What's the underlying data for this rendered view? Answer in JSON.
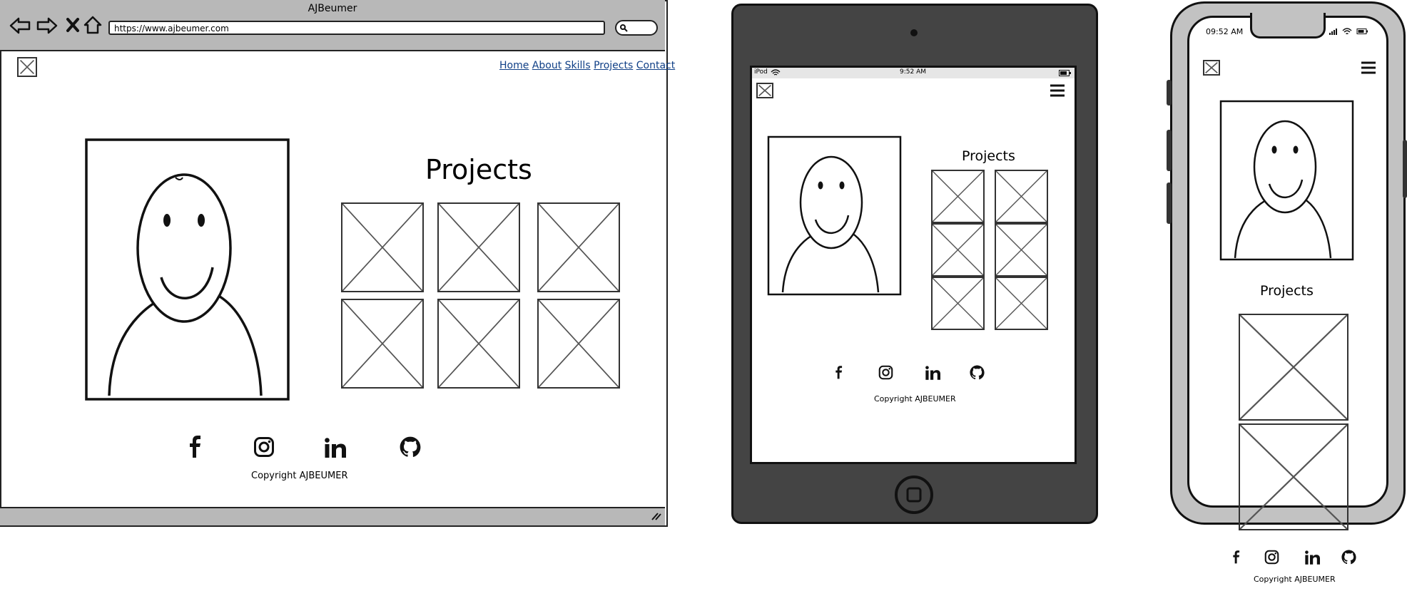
{
  "browser": {
    "title": "AJBeumer",
    "url": "https://www.ajbeumer.com",
    "nav": [
      "Home",
      "About",
      "Skills",
      "Projects",
      "Contact"
    ]
  },
  "tablet": {
    "status_device": "iPod",
    "status_time": "9:52 AM"
  },
  "phone": {
    "status_time": "09:52 AM"
  },
  "section_title": "Projects",
  "copyright": "Copyright AJBEUMER",
  "social_icons": [
    "facebook-icon",
    "instagram-icon",
    "linkedin-icon",
    "github-icon"
  ]
}
